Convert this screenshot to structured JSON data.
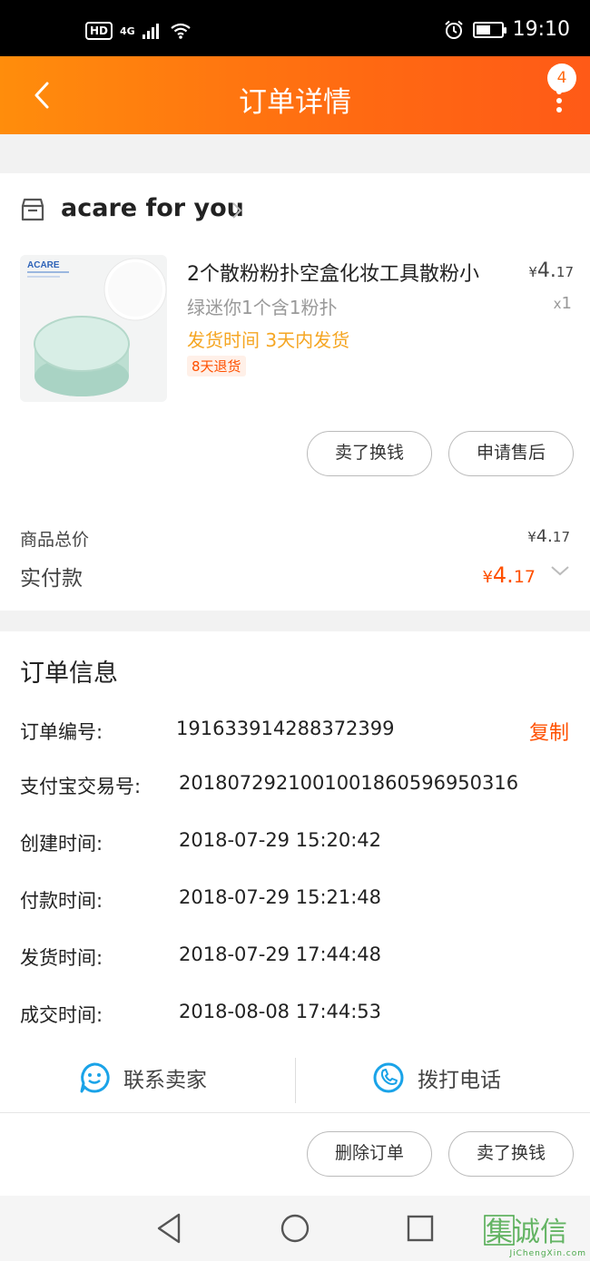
{
  "status_bar": {
    "hd": "HD",
    "network": "4G",
    "time": "19:10",
    "battery_level": 0.6
  },
  "nav": {
    "title": "订单详情",
    "badge_count": "4"
  },
  "shop": {
    "name": "acare for you"
  },
  "product": {
    "image_brand": "ACARE",
    "title": "2个散粉粉扑空盒化妆工具散粉小",
    "variant": "绿迷你1个含1粉扑",
    "shipping": "发货时间 3天内发货",
    "return_policy": "8天退货",
    "price_symbol": "¥",
    "price_int": "4.",
    "price_dec": "17",
    "qty": "1",
    "qty_prefix": "x"
  },
  "actions_top": {
    "sell": "卖了换钱",
    "after_sale": "申请售后"
  },
  "summary": {
    "total_label": "商品总价",
    "total_symbol": "¥",
    "total_int": "4.",
    "total_dec": "17",
    "paid_label": "实付款",
    "paid_symbol": "¥",
    "paid_int": "4.",
    "paid_dec": "17"
  },
  "order_info": {
    "title": "订单信息",
    "copy_label": "复制",
    "rows": [
      {
        "label": "订单编号:",
        "value": "191633914288372399"
      },
      {
        "label": "支付宝交易号:",
        "value": "2018072921001001860596950316"
      },
      {
        "label": "创建时间:",
        "value": "2018-07-29 15:20:42"
      },
      {
        "label": "付款时间:",
        "value": "2018-07-29 15:21:48"
      },
      {
        "label": "发货时间:",
        "value": "2018-07-29 17:44:48"
      },
      {
        "label": "成交时间:",
        "value": "2018-08-08 17:44:53"
      }
    ]
  },
  "contact": {
    "seller": "联系卖家",
    "phone": "拨打电话"
  },
  "actions_bottom": {
    "delete": "删除订单",
    "sell": "卖了换钱"
  },
  "watermark": {
    "text": "JiChengXin.com",
    "glyphs": "集诚信"
  },
  "colors": {
    "accent": "#ff5000",
    "nav_start": "#ff8d0c",
    "nav_end": "#ff5a17",
    "contact_blue": "#1aa3e8",
    "ship_yellow": "#f5a623"
  }
}
